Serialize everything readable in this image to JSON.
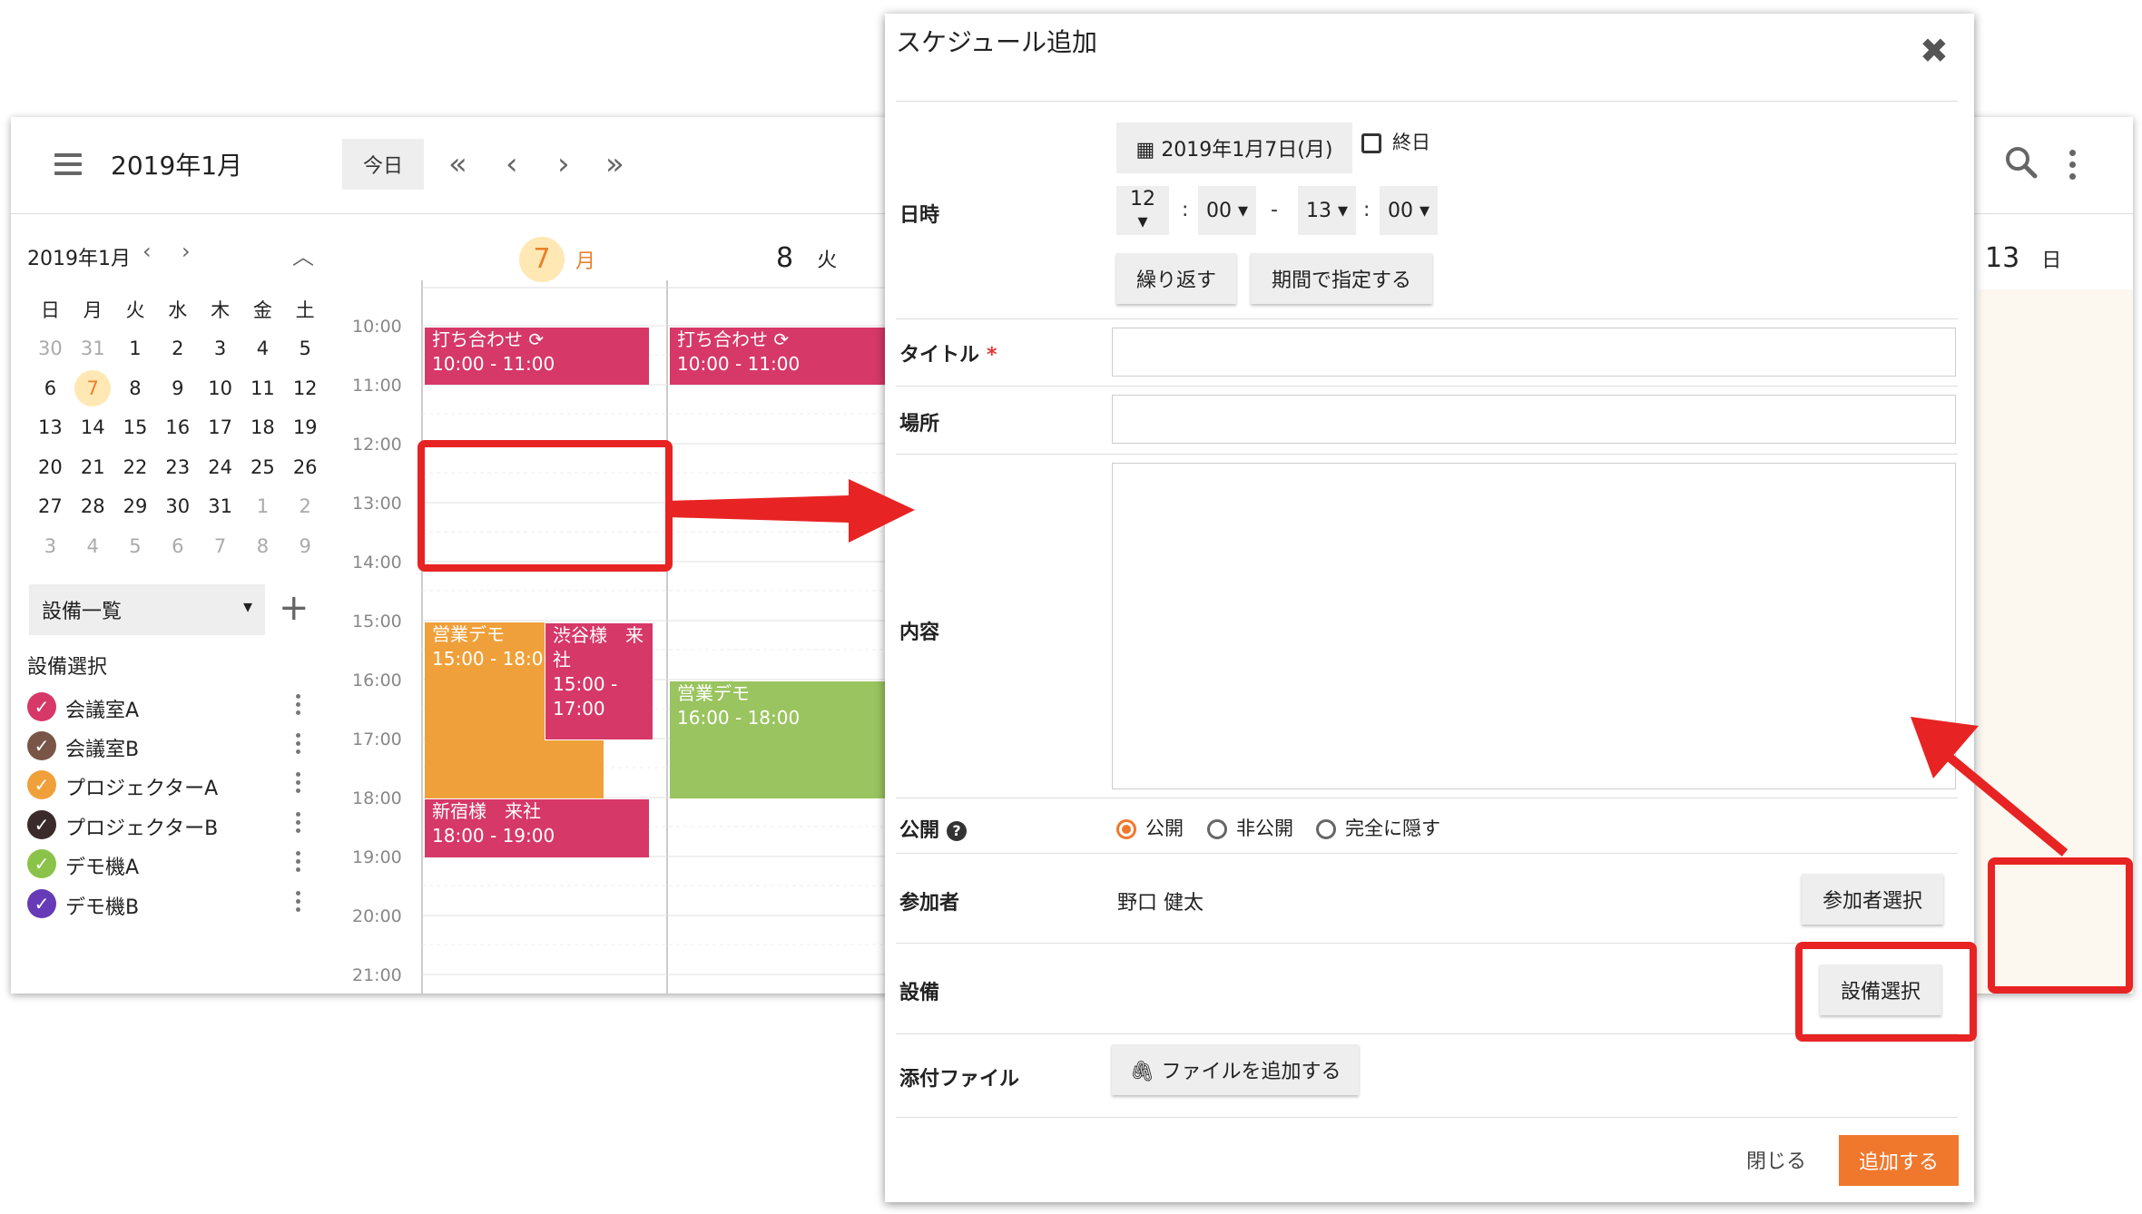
{
  "header": {
    "month_title": "2019年1月",
    "today_label": "今日",
    "nav": [
      "«",
      "‹",
      "›",
      "»"
    ]
  },
  "mini_calendar": {
    "title": "2019年1月",
    "prev": "‹",
    "next": "›",
    "collapse": "︿",
    "weekdays": [
      "日",
      "月",
      "火",
      "水",
      "木",
      "金",
      "土"
    ],
    "weeks": [
      [
        "30",
        "31",
        "1",
        "2",
        "3",
        "4",
        "5"
      ],
      [
        "6",
        "7",
        "8",
        "9",
        "10",
        "11",
        "12"
      ],
      [
        "13",
        "14",
        "15",
        "16",
        "17",
        "18",
        "19"
      ],
      [
        "20",
        "21",
        "22",
        "23",
        "24",
        "25",
        "26"
      ],
      [
        "27",
        "28",
        "29",
        "30",
        "31",
        "1",
        "2"
      ],
      [
        "3",
        "4",
        "5",
        "6",
        "7",
        "8",
        "9"
      ]
    ]
  },
  "sidebar": {
    "facility_dropdown": "設備一覧",
    "facility_heading": "設備選択",
    "facilities": [
      {
        "label": "会議室A",
        "color": "#d63868"
      },
      {
        "label": "会議室B",
        "color": "#795548"
      },
      {
        "label": "プロジェクターA",
        "color": "#f0a03a"
      },
      {
        "label": "プロジェクターB",
        "color": "#3a2a2a"
      },
      {
        "label": "デモ機A",
        "color": "#8bc34a"
      },
      {
        "label": "デモ機B",
        "color": "#673ab7"
      }
    ]
  },
  "days": [
    {
      "num": "7",
      "weekday": "月"
    },
    {
      "num": "8",
      "weekday": "火"
    },
    {
      "num": "13",
      "weekday": "日"
    }
  ],
  "time_labels": [
    "10:00",
    "11:00",
    "12:00",
    "13:00",
    "14:00",
    "15:00",
    "16:00",
    "17:00",
    "18:00",
    "19:00",
    "20:00",
    "21:00"
  ],
  "events": [
    {
      "title": "打ち合わせ",
      "time": "10:00 - 11:00"
    },
    {
      "title": "打ち合わせ",
      "time": "10:00 - 11:00"
    },
    {
      "title": "営業デモ",
      "time": "15:00 - 18:00"
    },
    {
      "title": "渋谷様　来社",
      "time": "15:00 - 17:00"
    },
    {
      "title": "営業デモ",
      "time": "16:00 - 18:00"
    },
    {
      "title": "新宿様　来社",
      "time": "18:00 - 19:00"
    }
  ],
  "dialog": {
    "title": "スケジュール追加",
    "close": "✖",
    "labels": {
      "datetime": "日時",
      "title": "タイトル",
      "required": "*",
      "location": "場所",
      "content": "内容",
      "visibility": "公開",
      "participants": "参加者",
      "facility": "設備",
      "attachment": "添付ファイル"
    },
    "date_value": "2019年1月7日(月)",
    "allday_label": "終日",
    "start_hour": "12",
    "start_min": "00",
    "end_hour": "13",
    "end_min": "00",
    "time_colon": ":",
    "time_dash": "-",
    "repeat_button": "繰り返す",
    "period_button": "期間で指定する",
    "visibility_options": [
      "公開",
      "非公開",
      "完全に隠す"
    ],
    "participant_name": "野口 健太",
    "participant_button": "参加者選択",
    "facility_button": "設備選択",
    "attach_button": "ファイルを追加する",
    "close_button": "閉じる",
    "add_button": "追加する"
  },
  "colors": {
    "accent": "#f0782d",
    "highlight": "#e82323",
    "event_pink": "#d63868",
    "event_orange": "#f0a03a",
    "event_green": "#9ac45f"
  }
}
